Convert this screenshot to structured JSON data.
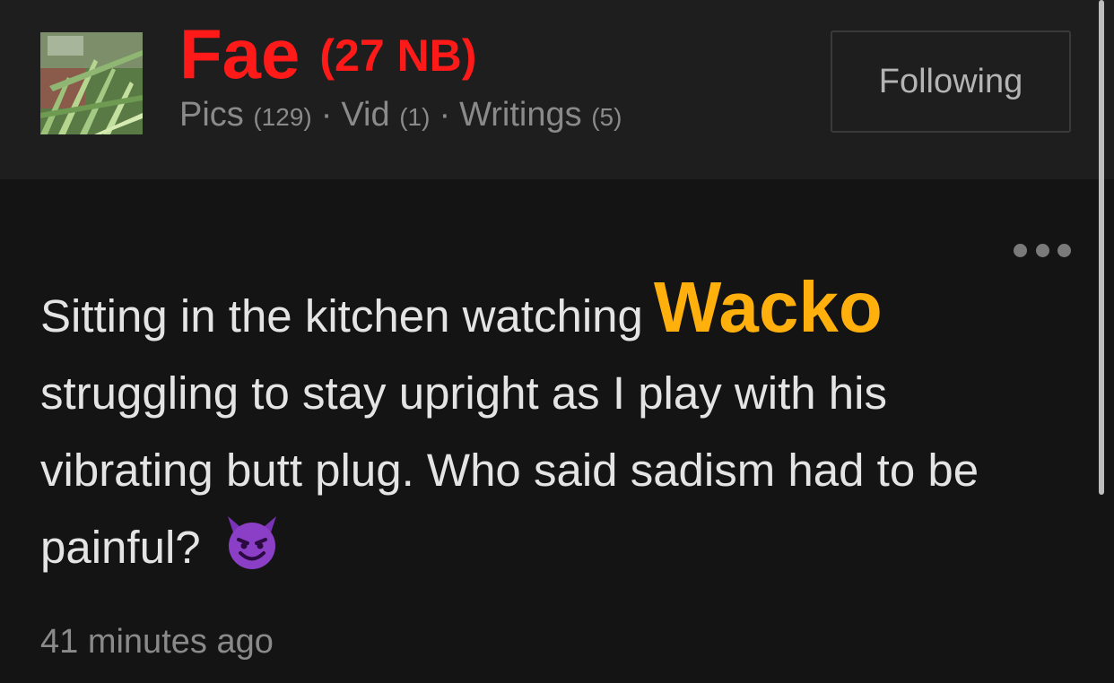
{
  "profile": {
    "name": "Fae",
    "tag": "(27 NB)",
    "stats": {
      "pics_label": "Pics",
      "pics_count": "(129)",
      "vid_label": "Vid",
      "vid_count": "(1)",
      "writings_label": "Writings",
      "writings_count": "(5)",
      "separator": "·"
    },
    "follow_button": "Following"
  },
  "post": {
    "mention": "Wacko",
    "line1": "Sitting in the kitchen watching",
    "text_rest": "struggling to stay upright as I play with his vibrating butt plug. Who said sadism had to be painful?",
    "emoji": "smiling-devil-emoji",
    "timestamp": "41 minutes ago"
  },
  "colors": {
    "name": "#ff1a1a",
    "mention": "#ffb00d",
    "background": "#141414",
    "header_background": "#1e1e1e",
    "muted_text": "#8a8a8a",
    "emoji": "#8a3fc6"
  }
}
